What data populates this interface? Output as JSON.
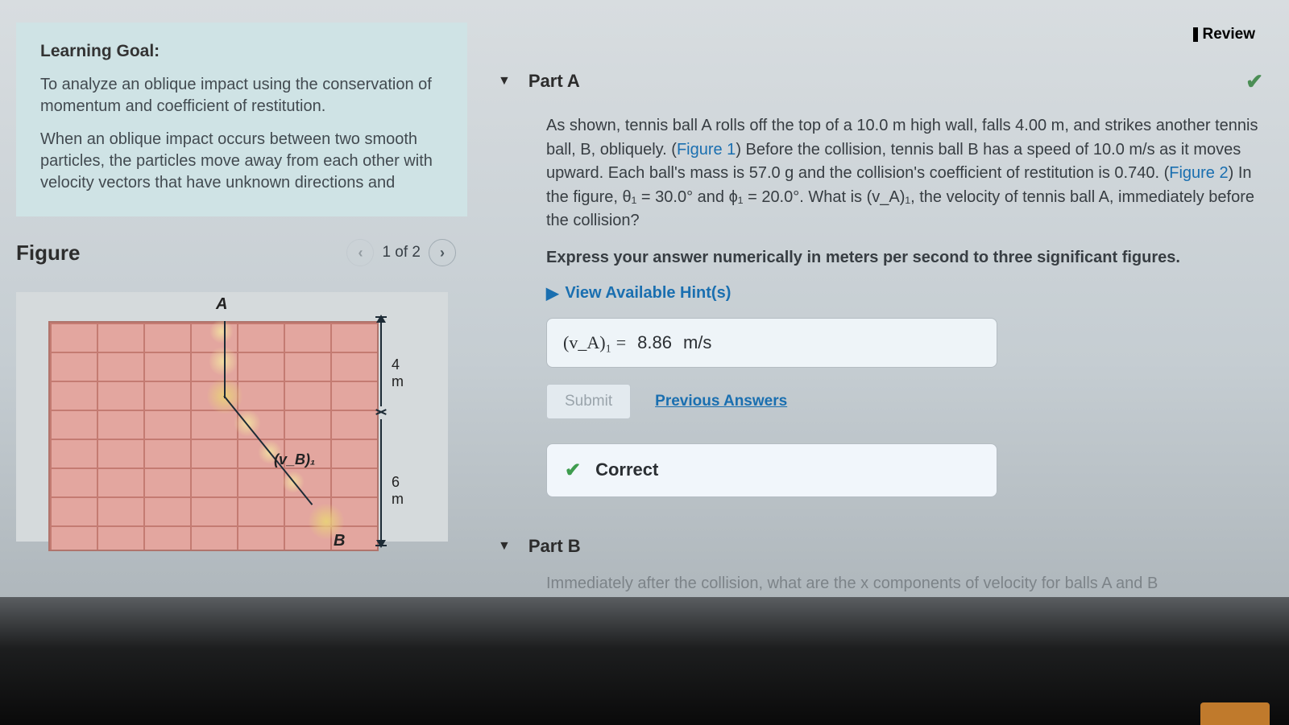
{
  "review_label": "Review",
  "learning_goal": {
    "heading": "Learning Goal:",
    "p1": "To analyze an oblique impact using the conservation of momentum and coefficient of restitution.",
    "p2": "When an oblique impact occurs between two smooth particles, the particles move away from each other with velocity vectors that have unknown directions and"
  },
  "figure": {
    "title": "Figure",
    "pager_text": "1 of 2",
    "label_A": "A",
    "label_B": "B",
    "label_vb1": "(v_B)₁",
    "dim_4m": "4 m",
    "dim_6m": "6 m"
  },
  "partA": {
    "title": "Part A",
    "body_pre": "As shown, tennis ball A rolls off the top of a 10.0 m high wall, falls 4.00 m, and strikes another tennis ball, B, obliquely. (",
    "fig1": "Figure 1",
    "body_mid": ") Before the collision, tennis ball B has a speed of 10.0 m/s as it moves upward. Each ball's mass is 57.0 g and the collision's coefficient of restitution is 0.740. (",
    "fig2": "Figure 2",
    "body_after": ") In the figure, θ₁ = 30.0° and ϕ₁ = 20.0°. What is (v_A)₁, the velocity of tennis ball A, immediately before the collision?",
    "express": "Express your answer numerically in meters per second to three significant figures.",
    "hints": "View Available Hint(s)",
    "answer_symbol": "(v_A)₁ =",
    "answer_value": "8.86",
    "answer_unit": "m/s",
    "submit": "Submit",
    "previous": "Previous Answers",
    "correct": "Correct"
  },
  "partB": {
    "title": "Part B",
    "teaser": "Immediately after the collision, what are the x components of velocity for balls A and B"
  }
}
